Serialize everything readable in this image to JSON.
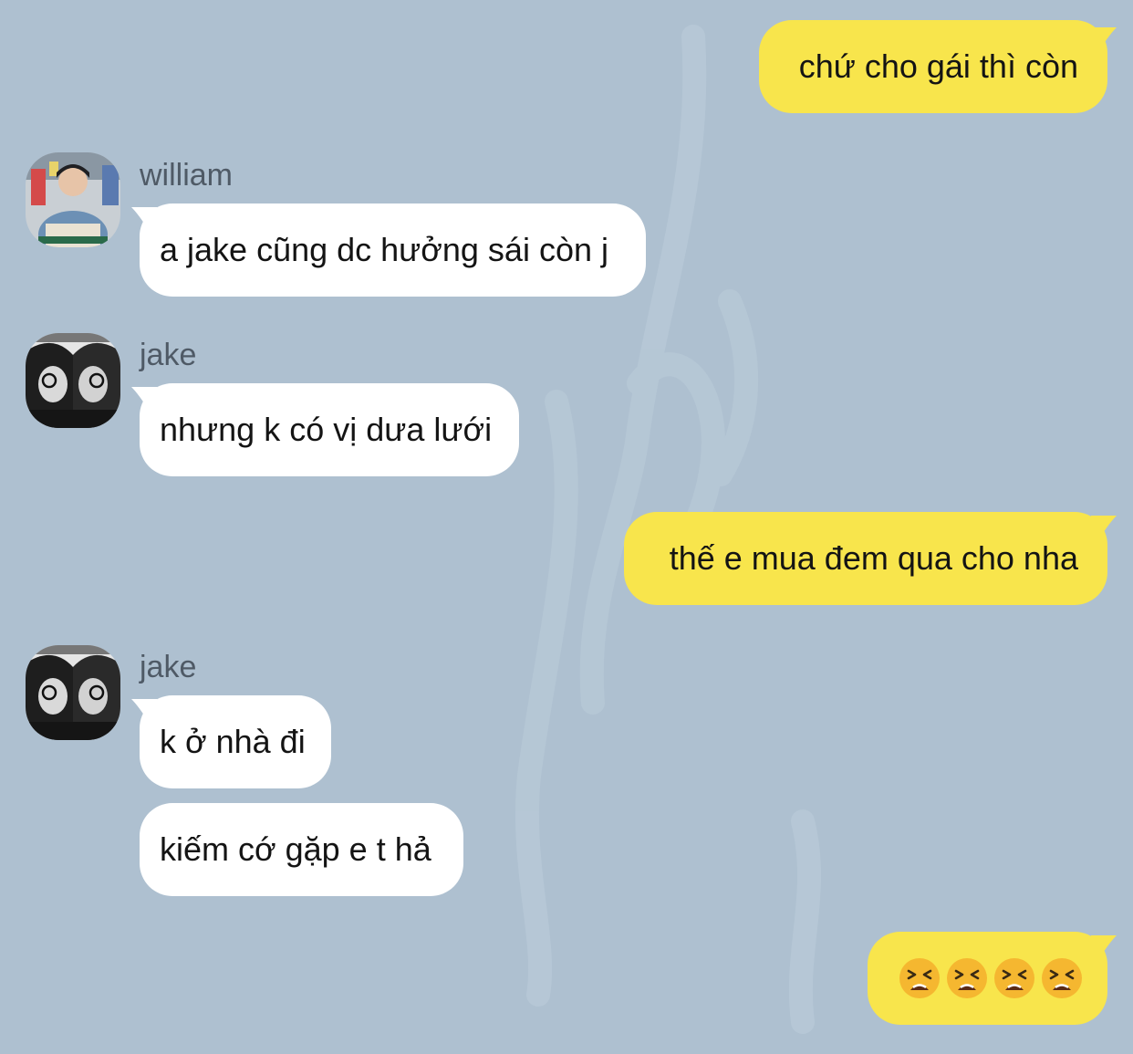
{
  "colors": {
    "background": "#aec0d0",
    "outgoing_bubble": "#f8e54c",
    "incoming_bubble": "#ffffff",
    "sender_name": "#4f5a66"
  },
  "messages": [
    {
      "direction": "outgoing",
      "text": "chứ cho gái thì còn"
    },
    {
      "direction": "incoming",
      "sender": "william",
      "avatar_icon": "william-avatar-icon",
      "text": "a jake cũng dc hưởng sái còn j"
    },
    {
      "direction": "incoming",
      "sender": "jake",
      "avatar_icon": "jake-avatar-icon",
      "text": "nhưng k có vị dưa lưới"
    },
    {
      "direction": "outgoing",
      "text": "thế e mua đem qua cho nha"
    },
    {
      "direction": "incoming",
      "sender": "jake",
      "avatar_icon": "jake-avatar-icon",
      "text": "k ở nhà đi"
    },
    {
      "direction": "incoming",
      "text": "kiếm cớ gặp e t hả"
    },
    {
      "direction": "outgoing",
      "emoji": [
        "tired-face-emoji",
        "tired-face-emoji",
        "tired-face-emoji",
        "tired-face-emoji"
      ]
    }
  ]
}
